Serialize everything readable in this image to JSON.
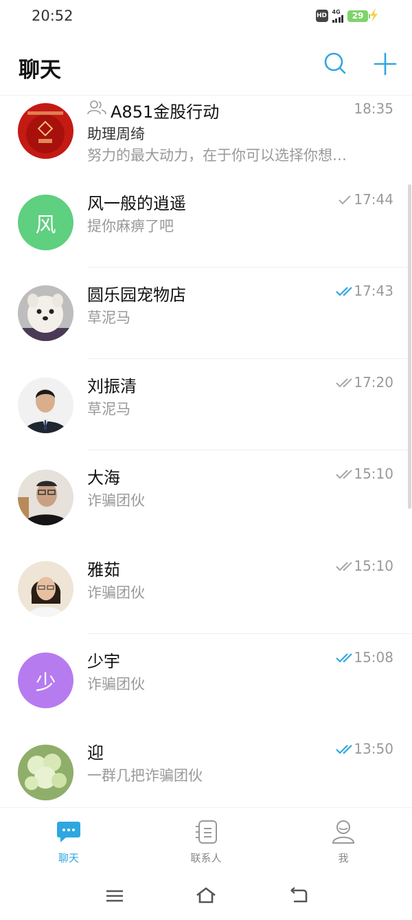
{
  "status_bar": {
    "time": "20:52",
    "hd": "HD",
    "network": "4G",
    "battery": "29"
  },
  "header": {
    "title": "聊天"
  },
  "chats": [
    {
      "name": "A851金股行动",
      "sender": "助理周绮",
      "preview": "努力的最大动力，在于你可以选择你想…",
      "time": "18:35",
      "status": "none",
      "group": true
    },
    {
      "name": "风一般的逍遥",
      "preview": "提你麻痹了吧",
      "time": "17:44",
      "status": "sent",
      "avatar_char": "风",
      "avatar_color": "#5fcf80"
    },
    {
      "name": "圆乐园宠物店",
      "preview": "草泥马",
      "time": "17:43",
      "status": "read"
    },
    {
      "name": "刘振清",
      "preview": "草泥马",
      "time": "17:20",
      "status": "delivered"
    },
    {
      "name": "大海",
      "preview": "诈骗团伙",
      "time": "15:10",
      "status": "delivered"
    },
    {
      "name": "雅茹",
      "preview": "诈骗团伙",
      "time": "15:10",
      "status": "delivered"
    },
    {
      "name": "少宇",
      "preview": "诈骗团伙",
      "time": "15:08",
      "status": "read",
      "avatar_char": "少",
      "avatar_color": "#b77bf0"
    },
    {
      "name": "迎",
      "preview": "一群几把诈骗团伙",
      "time": "13:50",
      "status": "read"
    }
  ],
  "tabs": [
    {
      "label": "聊天",
      "icon": "chat-bubble-icon",
      "active": true
    },
    {
      "label": "联系人",
      "icon": "contacts-book-icon",
      "active": false
    },
    {
      "label": "我",
      "icon": "person-icon",
      "active": false
    }
  ],
  "colors": {
    "accent": "#2ea7e0",
    "read_check": "#2ea7e0",
    "muted": "#9a9a9a",
    "battery": "#7fd36b"
  }
}
